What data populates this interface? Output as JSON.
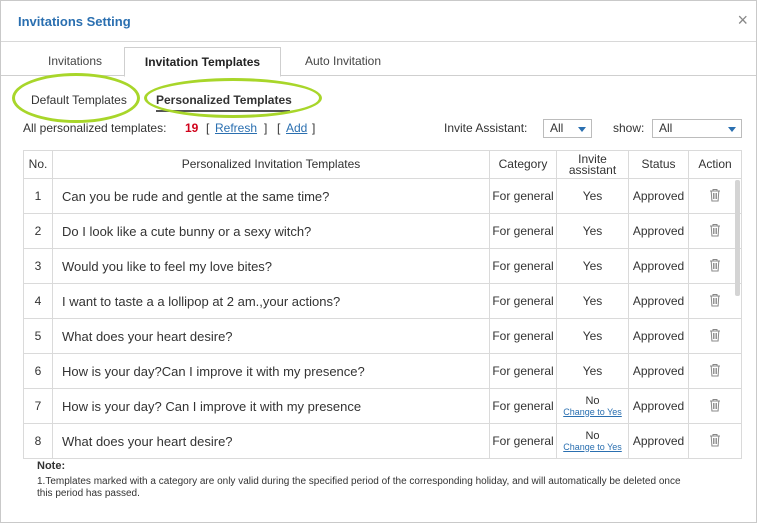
{
  "dialog": {
    "title": "Invitations Setting",
    "close_glyph": "×"
  },
  "tabs": [
    {
      "label": "Invitations"
    },
    {
      "label": "Invitation Templates"
    },
    {
      "label": "Auto Invitation"
    }
  ],
  "subtabs": [
    {
      "label": "Default Templates"
    },
    {
      "label": "Personalized Templates"
    }
  ],
  "filters": {
    "count_prefix": "All personalized templates:",
    "count": "19",
    "refresh_open": "[",
    "refresh_label": "Refresh",
    "refresh_close": "]",
    "add_open": "[",
    "add_label": "Add",
    "add_close": "]",
    "assistant_label": "Invite Assistant:",
    "assistant_value": "All",
    "show_label": "show:",
    "show_value": "All"
  },
  "table": {
    "headers": {
      "no": "No.",
      "template": "Personalized Invitation Templates",
      "category": "Category",
      "invite_line1": "Invite",
      "invite_line2": "assistant",
      "status": "Status",
      "action": "Action"
    },
    "rows": [
      {
        "no": "1",
        "text": "Can you be rude and gentle at the same time?",
        "category": "For general",
        "invite": "Yes",
        "change": "",
        "status": "Approved"
      },
      {
        "no": "2",
        "text": "Do I look like a cute bunny or a sexy witch?",
        "category": "For general",
        "invite": "Yes",
        "change": "",
        "status": "Approved"
      },
      {
        "no": "3",
        "text": "Would you like to feel my love bites?",
        "category": "For general",
        "invite": "Yes",
        "change": "",
        "status": "Approved"
      },
      {
        "no": "4",
        "text": "I want to taste a a lollipop at 2 am.,your actions?",
        "category": "For general",
        "invite": "Yes",
        "change": "",
        "status": "Approved"
      },
      {
        "no": "5",
        "text": "What does your heart desire?",
        "category": "For general",
        "invite": "Yes",
        "change": "",
        "status": "Approved"
      },
      {
        "no": "6",
        "text": "How is your day?Can I improve it with my presence?",
        "category": "For general",
        "invite": "Yes",
        "change": "",
        "status": "Approved"
      },
      {
        "no": "7",
        "text": "How is your day? Can I improve it with my presence",
        "category": "For general",
        "invite": "No",
        "change": "Change to Yes",
        "status": "Approved"
      },
      {
        "no": "8",
        "text": "What does your heart desire?",
        "category": "For general",
        "invite": "No",
        "change": "Change to Yes",
        "status": "Approved"
      }
    ]
  },
  "note": {
    "title": "Note:",
    "text": "1.Templates marked with a category are only valid during the specified period of the corresponding holiday, and will automatically be deleted once this period has passed."
  },
  "colors": {
    "accent": "#2a6fb0",
    "highlight": "#a8d62a",
    "count": "#d0021b"
  },
  "icons": {
    "close": "close-icon",
    "dropdown": "caret-down-icon",
    "delete": "trash-icon"
  }
}
